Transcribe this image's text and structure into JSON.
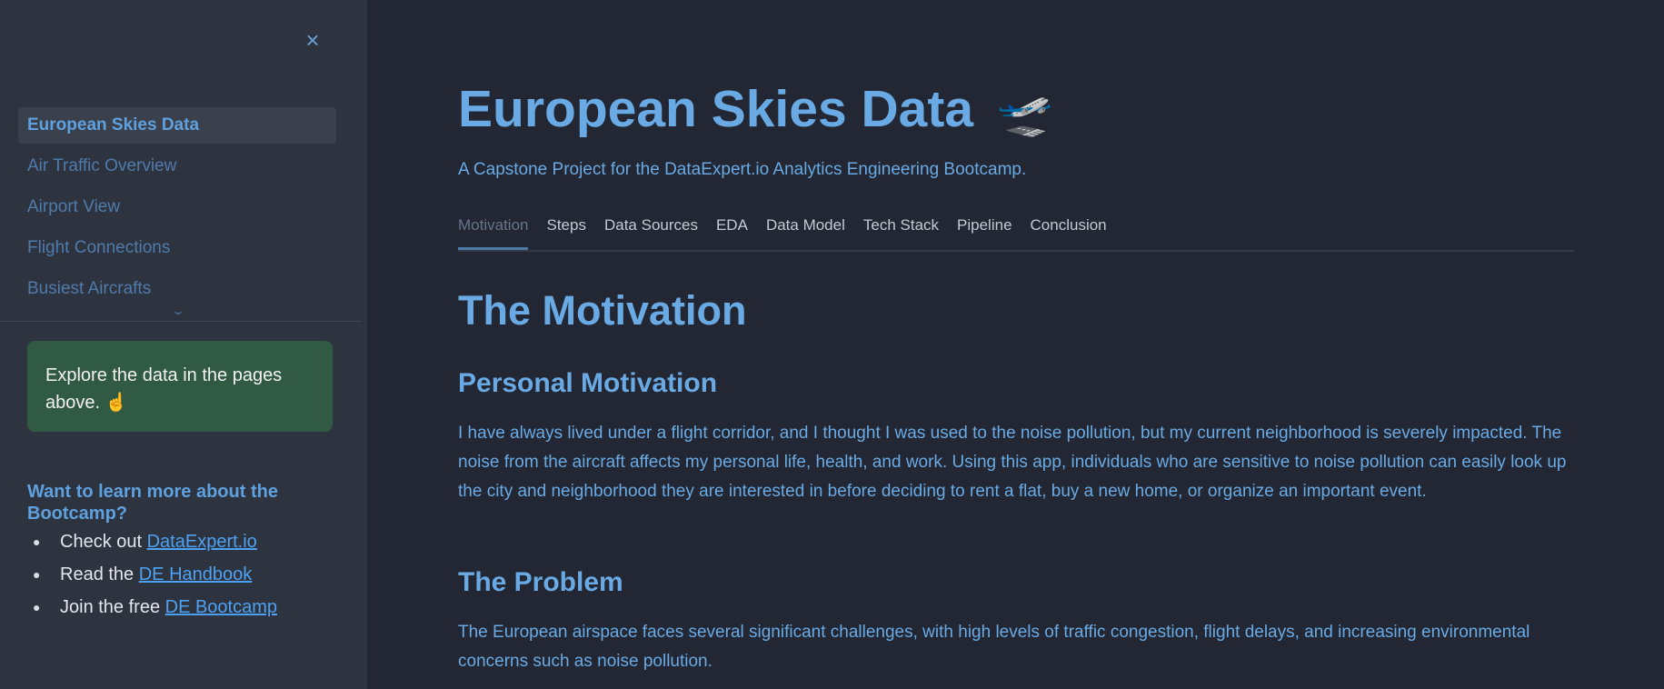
{
  "sidebar": {
    "close_label": "×",
    "nav_items": [
      {
        "label": "European Skies Data",
        "active": true
      },
      {
        "label": "Air Traffic Overview",
        "active": false
      },
      {
        "label": "Airport View",
        "active": false
      },
      {
        "label": "Flight Connections",
        "active": false
      },
      {
        "label": "Busiest Aircrafts",
        "active": false
      }
    ],
    "expand_chevron": "⌄",
    "info_box": {
      "text": "Explore the data in the pages above.",
      "emoji": "☝️"
    },
    "learn_heading": "Want to learn more about the Bootcamp?",
    "links": [
      {
        "prefix": "Check out ",
        "link_text": "DataExpert.io"
      },
      {
        "prefix": "Read the ",
        "link_text": "DE Handbook"
      },
      {
        "prefix": "Join the free ",
        "link_text": "DE Bootcamp"
      }
    ]
  },
  "main": {
    "title": "European Skies Data",
    "title_emoji": "🛫",
    "subtitle": "A Capstone Project for the DataExpert.io Analytics Engineering Bootcamp.",
    "tabs": [
      {
        "label": "Motivation",
        "active": true
      },
      {
        "label": "Steps",
        "active": false
      },
      {
        "label": "Data Sources",
        "active": false
      },
      {
        "label": "EDA",
        "active": false
      },
      {
        "label": "Data Model",
        "active": false
      },
      {
        "label": "Tech Stack",
        "active": false
      },
      {
        "label": "Pipeline",
        "active": false
      },
      {
        "label": "Conclusion",
        "active": false
      }
    ],
    "section_title": "The Motivation",
    "personal_heading": "Personal Motivation",
    "personal_text": "I have always lived under a flight corridor, and I thought I was used to the noise pollution, but my current neighborhood is severely impacted. The noise from the aircraft affects my personal life, health, and work. Using this app, individuals who are sensitive to noise pollution can easily look up the city and neighborhood they are interested in before deciding to rent a flat, buy a new home, or organize an important event.",
    "problem_heading": "The Problem",
    "problem_text": "The European airspace faces several significant challenges, with high levels of traffic congestion, flight delays, and increasing environmental concerns such as noise pollution."
  },
  "colors": {
    "sidebar_background": "#2e3340",
    "main_background": "#222733",
    "accent_blue": "#6aaae4",
    "info_green": "#315a45",
    "link_blue": "#4ea1f0"
  }
}
